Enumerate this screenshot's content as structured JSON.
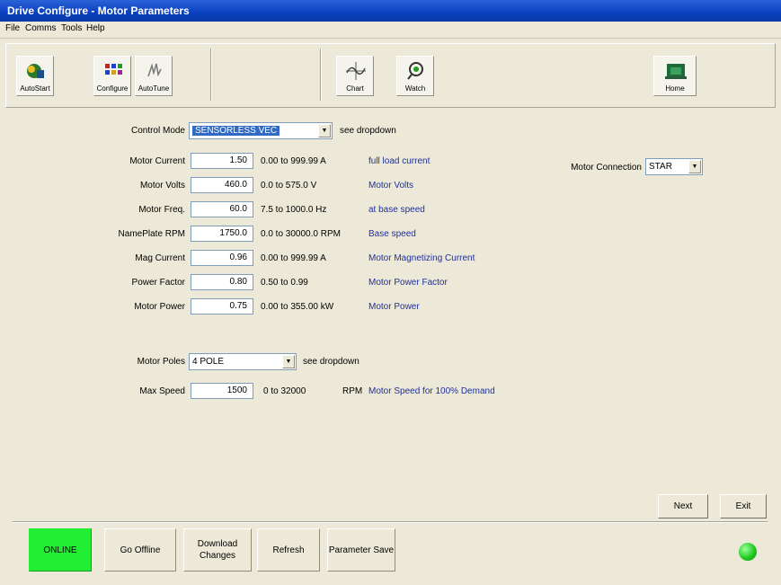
{
  "window": {
    "title": "Drive Configure - Motor Parameters"
  },
  "menu": [
    "File",
    "Comms",
    "Tools",
    "Help"
  ],
  "toolbar": {
    "autostart": "AutoStart",
    "configure": "Configure",
    "autotune": "AutoTune",
    "chart": "Chart",
    "watch": "Watch",
    "home": "Home"
  },
  "control_mode": {
    "label": "Control Mode",
    "value": "SENSORLESS VEC",
    "hint": "see dropdown"
  },
  "params": [
    {
      "label": "Motor Current",
      "value": "1.50",
      "range": "0.00 to 999.99 A",
      "desc": "full load current"
    },
    {
      "label": "Motor Volts",
      "value": "460.0",
      "range": "0.0 to 575.0 V",
      "desc": "Motor Volts"
    },
    {
      "label": "Motor Freq.",
      "value": "60.0",
      "range": "7.5 to 1000.0 Hz",
      "desc": "at base speed"
    },
    {
      "label": "NamePlate RPM",
      "value": "1750.0",
      "range": "0.0 to 30000.0 RPM",
      "desc": "Base speed"
    },
    {
      "label": "Mag Current",
      "value": "0.96",
      "range": "0.00 to 999.99 A",
      "desc": "Motor Magnetizing Current"
    },
    {
      "label": "Power Factor",
      "value": "0.80",
      "range": "0.50 to 0.99",
      "desc": "Motor Power Factor"
    },
    {
      "label": "Motor Power",
      "value": "0.75",
      "range": "0.00 to 355.00 kW",
      "desc": "Motor Power"
    }
  ],
  "motor_connection": {
    "label": "Motor Connection",
    "value": "STAR"
  },
  "motor_poles": {
    "label": "Motor Poles",
    "value": "4 POLE",
    "hint": "see dropdown"
  },
  "max_speed": {
    "label": "Max Speed",
    "value": "1500",
    "range": "0 to 32000",
    "unit": "RPM",
    "desc": "Motor Speed for 100% Demand"
  },
  "nav": {
    "next": "Next",
    "exit": "Exit"
  },
  "bottom": {
    "online": "ONLINE",
    "go_offline": "Go Offline",
    "download": "Download Changes",
    "refresh": "Refresh",
    "param_save": "Parameter Save"
  },
  "colors": {
    "online_bg": "#22ee33",
    "status_led": "#22cc22",
    "title_bar": "#0a3fbf",
    "desc_text": "#1f2f9c"
  }
}
